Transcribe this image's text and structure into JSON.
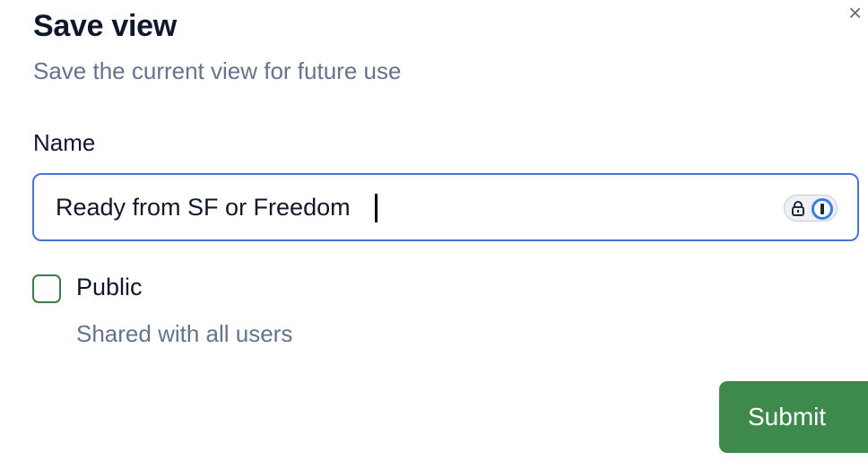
{
  "dialog": {
    "title": "Save view",
    "subtitle": "Save the current view for future use",
    "close_glyph": "×"
  },
  "name_field": {
    "label": "Name",
    "value": "Ready from SF or Freedom",
    "password_manager_icon": "1password-icon"
  },
  "public_option": {
    "label": "Public",
    "description": "Shared with all users",
    "checked": false
  },
  "actions": {
    "submit_label": "Submit"
  },
  "colors": {
    "accent_green": "#3e8a4c",
    "focus_blue": "#4a72d9",
    "muted_text": "#64748b"
  }
}
